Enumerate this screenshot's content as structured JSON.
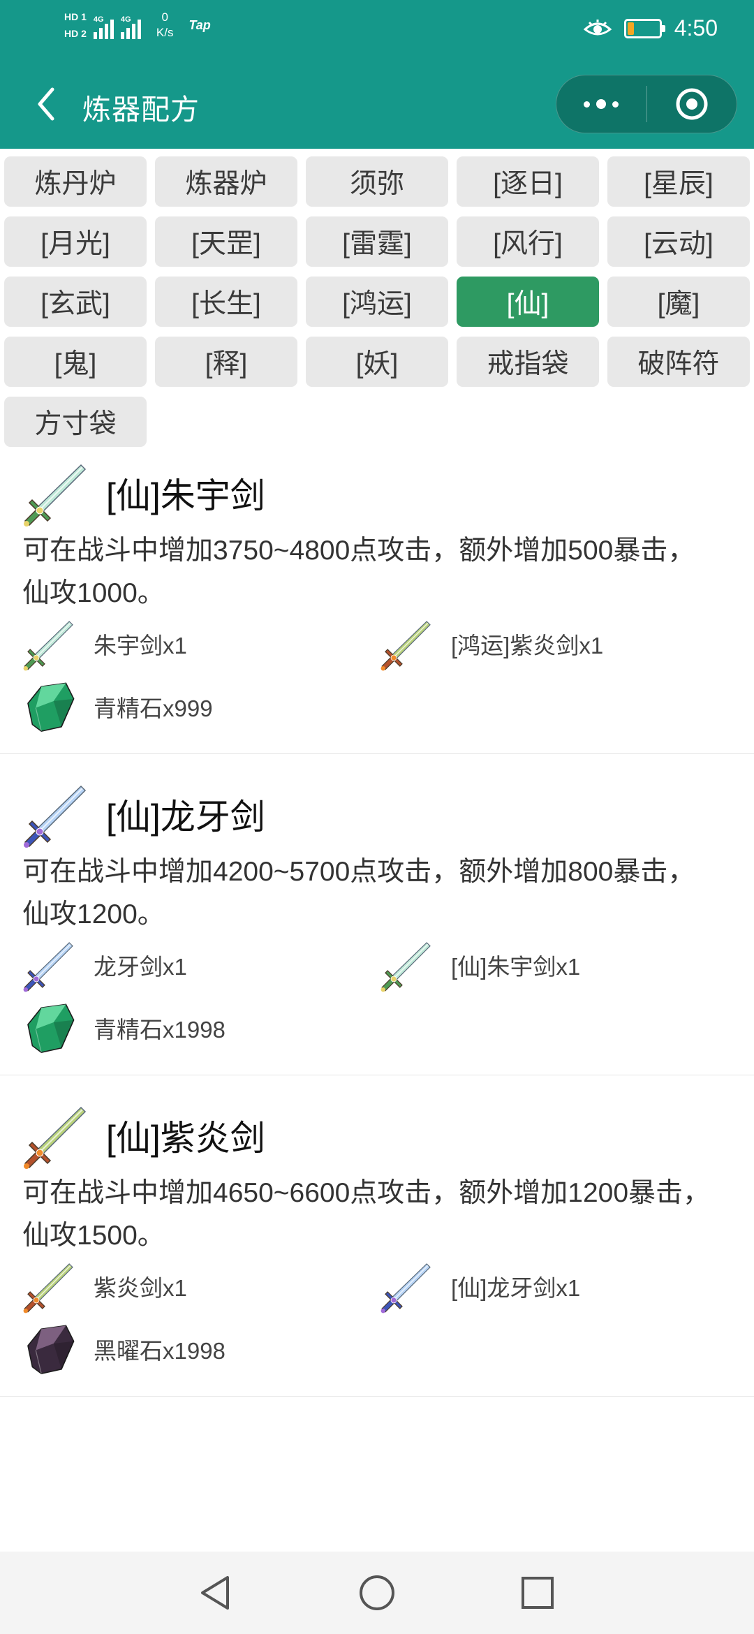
{
  "status": {
    "hd1": "HD 1",
    "hd2": "HD 2",
    "net1": "4G",
    "net2": "4G",
    "speed_value": "0",
    "speed_unit": "K/s",
    "tap": "Tap",
    "battery_level_pct": 20,
    "time": "4:50",
    "icons": [
      "eye-icon",
      "battery-icon"
    ]
  },
  "header": {
    "title": "炼器配方",
    "back_icon": "back-icon",
    "more_icon": "more-dots-icon",
    "close_icon": "target-close-icon"
  },
  "categories": [
    {
      "label": "炼丹炉",
      "active": false
    },
    {
      "label": "炼器炉",
      "active": false
    },
    {
      "label": "须弥",
      "active": false
    },
    {
      "label": "[逐日]",
      "active": false
    },
    {
      "label": "[星辰]",
      "active": false
    },
    {
      "label": "[月光]",
      "active": false
    },
    {
      "label": "[天罡]",
      "active": false
    },
    {
      "label": "[雷霆]",
      "active": false
    },
    {
      "label": "[风行]",
      "active": false
    },
    {
      "label": "[云动]",
      "active": false
    },
    {
      "label": "[玄武]",
      "active": false
    },
    {
      "label": "[长生]",
      "active": false
    },
    {
      "label": "[鸿运]",
      "active": false
    },
    {
      "label": "[仙]",
      "active": true
    },
    {
      "label": "[魔]",
      "active": false
    },
    {
      "label": "[鬼]",
      "active": false
    },
    {
      "label": "[释]",
      "active": false
    },
    {
      "label": "[妖]",
      "active": false
    },
    {
      "label": "戒指袋",
      "active": false
    },
    {
      "label": "破阵符",
      "active": false
    },
    {
      "label": "方寸袋",
      "active": false
    }
  ],
  "recipes": [
    {
      "title": "[仙]朱宇剑",
      "icon": "jade-sword-icon",
      "description": "可在战斗中增加3750~4800点攻击，额外增加500暴击，仙攻1000。",
      "materials": [
        {
          "name": "朱宇剑x1",
          "icon": "jade-sword-icon"
        },
        {
          "name": "[鸿运]紫炎剑x1",
          "icon": "flame-sword-icon"
        },
        {
          "name": "青精石x999",
          "icon": "green-crystal-icon"
        }
      ]
    },
    {
      "title": "[仙]龙牙剑",
      "icon": "blue-sword-icon",
      "description": "可在战斗中增加4200~5700点攻击，额外增加800暴击，仙攻1200。",
      "materials": [
        {
          "name": "龙牙剑x1",
          "icon": "blue-sword-icon"
        },
        {
          "name": "[仙]朱宇剑x1",
          "icon": "jade-sword-icon"
        },
        {
          "name": "青精石x1998",
          "icon": "green-crystal-icon"
        }
      ]
    },
    {
      "title": "[仙]紫炎剑",
      "icon": "flame-sword-icon",
      "description": "可在战斗中增加4650~6600点攻击，额外增加1200暴击，仙攻1500。",
      "materials": [
        {
          "name": "紫炎剑x1",
          "icon": "flame-sword-icon"
        },
        {
          "name": "[仙]龙牙剑x1",
          "icon": "blue-sword-icon"
        },
        {
          "name": "黑曜石x1998",
          "icon": "obsidian-icon"
        }
      ]
    }
  ],
  "navbar": {
    "back": "nav-back-icon",
    "home": "nav-home-icon",
    "recent": "nav-recent-icon"
  },
  "colors": {
    "header": "#15988a",
    "chip": "#e8e8e8",
    "chip_active": "#2e9a62",
    "battery": "#f5a623"
  }
}
